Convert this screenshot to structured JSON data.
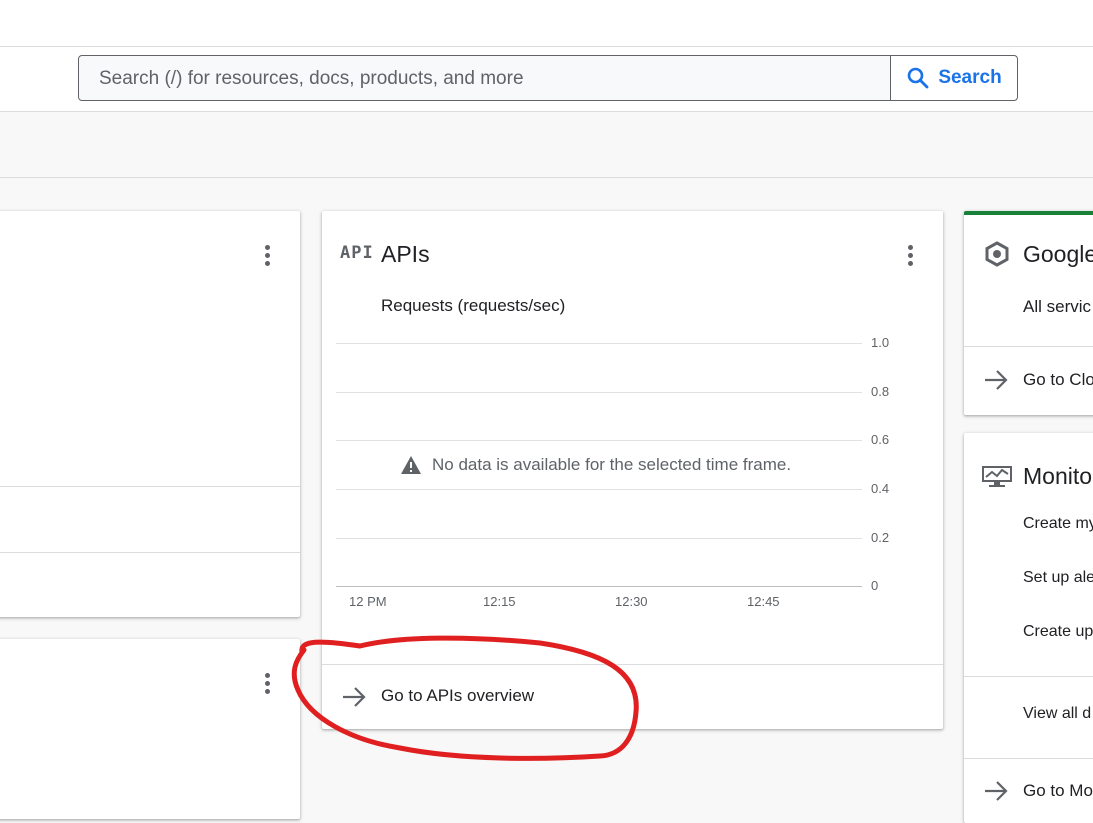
{
  "search": {
    "placeholder": "Search (/) for resources, docs, products, and more",
    "button_label": "Search",
    "accent_color": "#1a73e8"
  },
  "apis_card": {
    "icon_label": "API",
    "title": "APIs",
    "chart_title": "Requests (requests/sec)",
    "no_data_message": "No data is available for the selected time frame.",
    "link_label": "Go to APIs overview"
  },
  "chart_data": {
    "type": "line",
    "title": "Requests (requests/sec)",
    "x_ticks": [
      "12 PM",
      "12:15",
      "12:30",
      "12:45"
    ],
    "y_ticks": [
      "1.0",
      "0.8",
      "0.6",
      "0.4",
      "0.2",
      "0"
    ],
    "ylim": [
      0,
      1.0
    ],
    "series": [],
    "grid": true
  },
  "right_cards": {
    "google_card": {
      "title": "Google",
      "subtitle": "All servic",
      "link_label": "Go to Clo"
    },
    "monitoring_card": {
      "title": "Monito",
      "items": [
        "Create my",
        "Set up ale",
        "Create up"
      ],
      "view_all": "View all d",
      "link_label": "Go to Mo"
    }
  },
  "annotation": {
    "color": "#e02020"
  }
}
